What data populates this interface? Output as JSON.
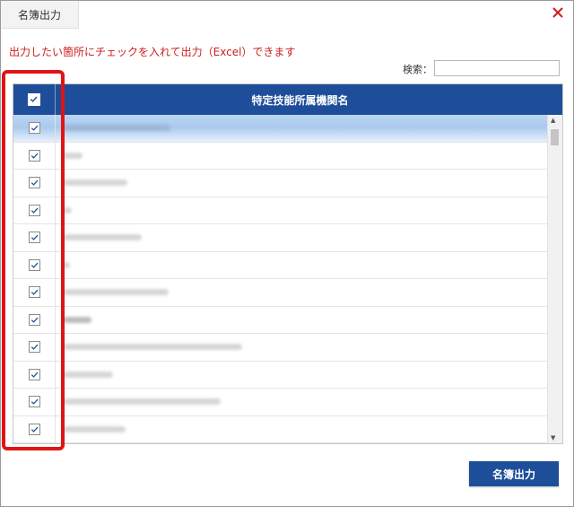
{
  "dialog": {
    "tab_title": "名簿出力",
    "instruction": "出力したい箇所にチェックを入れて出力（Excel）できます",
    "search": {
      "label": "検索：",
      "value": ""
    },
    "table": {
      "header": "特定技能所属機関名",
      "header_checked": true,
      "rows": [
        {
          "checked": true,
          "selected": true
        },
        {
          "checked": true
        },
        {
          "checked": true
        },
        {
          "checked": true
        },
        {
          "checked": true
        },
        {
          "checked": true
        },
        {
          "checked": true
        },
        {
          "checked": true
        },
        {
          "checked": true
        },
        {
          "checked": true
        },
        {
          "checked": true
        },
        {
          "checked": true
        }
      ]
    },
    "export_button": "名簿出力"
  },
  "colors": {
    "accent": "#1d4e99",
    "instruction": "#cc1f1f",
    "highlight": "#e01414",
    "close": "#d11a1a"
  }
}
